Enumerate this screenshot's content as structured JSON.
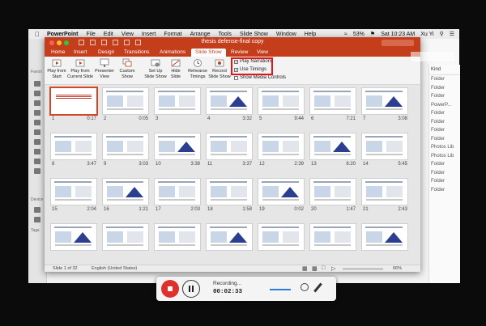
{
  "menubar": {
    "app": "PowerPoint",
    "items": [
      "File",
      "Edit",
      "View",
      "Insert",
      "Format",
      "Arrange",
      "Tools",
      "Slide Show",
      "Window",
      "Help"
    ],
    "battery": "53%",
    "clock": "Sat 10:23 AM",
    "user": "Xu Yi"
  },
  "finder": {
    "sidebar_labels": [
      "Favori",
      "Device",
      "Tags"
    ],
    "kind_header": "Kind",
    "kinds": [
      "Folder",
      "Folder",
      "Folder",
      "PowerP...",
      "Folder",
      "Folder",
      "Folder",
      "Folder",
      "Photos Lib",
      "Photos Lib",
      "Folder",
      "Folder",
      "Folder",
      "Folder"
    ]
  },
  "window": {
    "title": "thesis defense-final copy",
    "tabs": [
      "Home",
      "Insert",
      "Design",
      "Transitions",
      "Animations",
      "Slide Show",
      "Review",
      "View"
    ],
    "active_tab": "Slide Show"
  },
  "ribbon": {
    "buttons": [
      {
        "label1": "Play from",
        "label2": "Start"
      },
      {
        "label1": "Play from",
        "label2": "Current Slide"
      },
      {
        "label1": "Presenter",
        "label2": "View"
      },
      {
        "label1": "Custom",
        "label2": "Show"
      },
      {
        "label1": "Set Up",
        "label2": "Slide Show"
      },
      {
        "label1": "Hide",
        "label2": "Slide"
      },
      {
        "label1": "Rehearse",
        "label2": "Timings"
      },
      {
        "label1": "Record",
        "label2": "Slide Show"
      }
    ],
    "checks": [
      {
        "label": "Play Narrations",
        "checked": true
      },
      {
        "label": "Use Timings",
        "checked": true
      },
      {
        "label": "Show Media Controls",
        "checked": false
      }
    ]
  },
  "slides": [
    {
      "n": "1",
      "t": "0:17"
    },
    {
      "n": "2",
      "t": "0:05"
    },
    {
      "n": "3",
      "t": ""
    },
    {
      "n": "4",
      "t": "3:32"
    },
    {
      "n": "5",
      "t": "9:44"
    },
    {
      "n": "6",
      "t": "7:21"
    },
    {
      "n": "7",
      "t": "3:08"
    },
    {
      "n": "8",
      "t": "3:47"
    },
    {
      "n": "9",
      "t": "3:03"
    },
    {
      "n": "10",
      "t": "3:38"
    },
    {
      "n": "11",
      "t": "3:37"
    },
    {
      "n": "12",
      "t": "2:39"
    },
    {
      "n": "13",
      "t": "6:20"
    },
    {
      "n": "14",
      "t": "5:45"
    },
    {
      "n": "15",
      "t": "2:04"
    },
    {
      "n": "16",
      "t": "1:21"
    },
    {
      "n": "17",
      "t": "2:03"
    },
    {
      "n": "18",
      "t": "1:58"
    },
    {
      "n": "19",
      "t": "0:02"
    },
    {
      "n": "20",
      "t": "1:47"
    },
    {
      "n": "21",
      "t": "2:43"
    },
    {
      "n": "",
      "t": ""
    },
    {
      "n": "",
      "t": ""
    },
    {
      "n": "",
      "t": ""
    },
    {
      "n": "",
      "t": ""
    },
    {
      "n": "",
      "t": ""
    },
    {
      "n": "",
      "t": ""
    },
    {
      "n": "",
      "t": ""
    }
  ],
  "status": {
    "slide_count": "Slide 1 of 32",
    "language": "English (United States)",
    "zoom": "66%"
  },
  "recorder": {
    "label": "Recording...",
    "time": "00:02:33"
  }
}
